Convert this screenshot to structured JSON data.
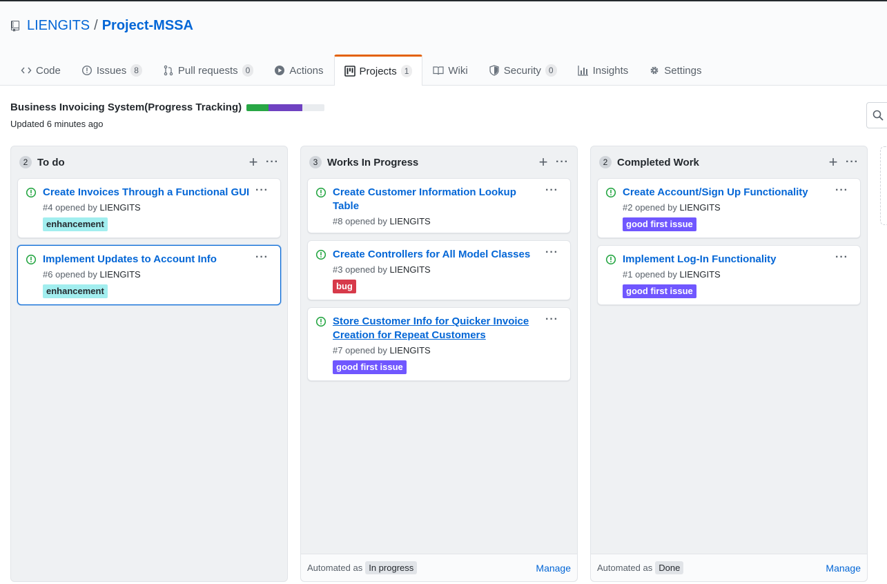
{
  "repo": {
    "owner": "LIENGITS",
    "separator": "/",
    "name": "Project-MSSA"
  },
  "tabs": [
    {
      "label": "Code",
      "icon": "code-icon",
      "counter": null,
      "selected": false
    },
    {
      "label": "Issues",
      "icon": "issue-opened-icon",
      "counter": "8",
      "selected": false
    },
    {
      "label": "Pull requests",
      "icon": "git-pull-request-icon",
      "counter": "0",
      "selected": false
    },
    {
      "label": "Actions",
      "icon": "play-icon",
      "counter": null,
      "selected": false
    },
    {
      "label": "Projects",
      "icon": "project-icon",
      "counter": "1",
      "selected": true
    },
    {
      "label": "Wiki",
      "icon": "book-icon",
      "counter": null,
      "selected": false
    },
    {
      "label": "Security",
      "icon": "shield-icon",
      "counter": "0",
      "selected": false
    },
    {
      "label": "Insights",
      "icon": "graph-icon",
      "counter": null,
      "selected": false
    },
    {
      "label": "Settings",
      "icon": "gear-icon",
      "counter": null,
      "selected": false
    }
  ],
  "project": {
    "name": "Business Invoicing System(Progress Tracking)",
    "updated": "Updated 6 minutes ago",
    "progress": {
      "done_fraction": 0.286,
      "in_progress_fraction": 0.428,
      "done_color": "#28a745",
      "in_progress_color": "#6f42c1",
      "todo_color": "#e9ecef"
    }
  },
  "columns": [
    {
      "count": "2",
      "title": "To do",
      "cards": [
        {
          "title": "Create Invoices Through a Functional GUI",
          "number": "#4",
          "opened_by": "opened by",
          "author": "LIENGITS",
          "label": "enhancement",
          "label_bg": "#a2eeef",
          "label_fg": "#24292e",
          "focused": false,
          "underline": false
        },
        {
          "title": "Implement Updates to Account Info",
          "number": "#6",
          "opened_by": "opened by",
          "author": "LIENGITS",
          "label": "enhancement",
          "label_bg": "#a2eeef",
          "label_fg": "#24292e",
          "focused": true,
          "underline": false
        }
      ],
      "footer": null
    },
    {
      "count": "3",
      "title": "Works In Progress",
      "cards": [
        {
          "title": "Create Customer Information Lookup Table",
          "number": "#8",
          "opened_by": "opened by",
          "author": "LIENGITS",
          "label": null,
          "focused": false,
          "underline": false
        },
        {
          "title": "Create Controllers for All Model Classes",
          "number": "#3",
          "opened_by": "opened by",
          "author": "LIENGITS",
          "label": "bug",
          "label_bg": "#d73a4a",
          "label_fg": "#ffffff",
          "focused": false,
          "underline": false
        },
        {
          "title": "Store Customer Info for Quicker Invoice Creation for Repeat Customers",
          "number": "#7",
          "opened_by": "opened by",
          "author": "LIENGITS",
          "label": "good first issue",
          "label_bg": "#7057ff",
          "label_fg": "#ffffff",
          "focused": false,
          "underline": true
        }
      ],
      "footer": {
        "automated_as": "Automated as",
        "state": "In progress",
        "manage": "Manage"
      }
    },
    {
      "count": "2",
      "title": "Completed Work",
      "cards": [
        {
          "title": "Create Account/Sign Up Functionality",
          "number": "#2",
          "opened_by": "opened by",
          "author": "LIENGITS",
          "label": "good first issue",
          "label_bg": "#7057ff",
          "label_fg": "#ffffff",
          "focused": false,
          "underline": false
        },
        {
          "title": "Implement Log-In Functionality",
          "number": "#1",
          "opened_by": "opened by",
          "author": "LIENGITS",
          "label": "good first issue",
          "label_bg": "#7057ff",
          "label_fg": "#ffffff",
          "focused": false,
          "underline": false
        }
      ],
      "footer": {
        "automated_as": "Automated as",
        "state": "Done",
        "manage": "Manage"
      }
    }
  ],
  "colors": {
    "link": "#0366d6",
    "issue_open": "#28a745",
    "selected_tab_accent": "#e36209"
  }
}
